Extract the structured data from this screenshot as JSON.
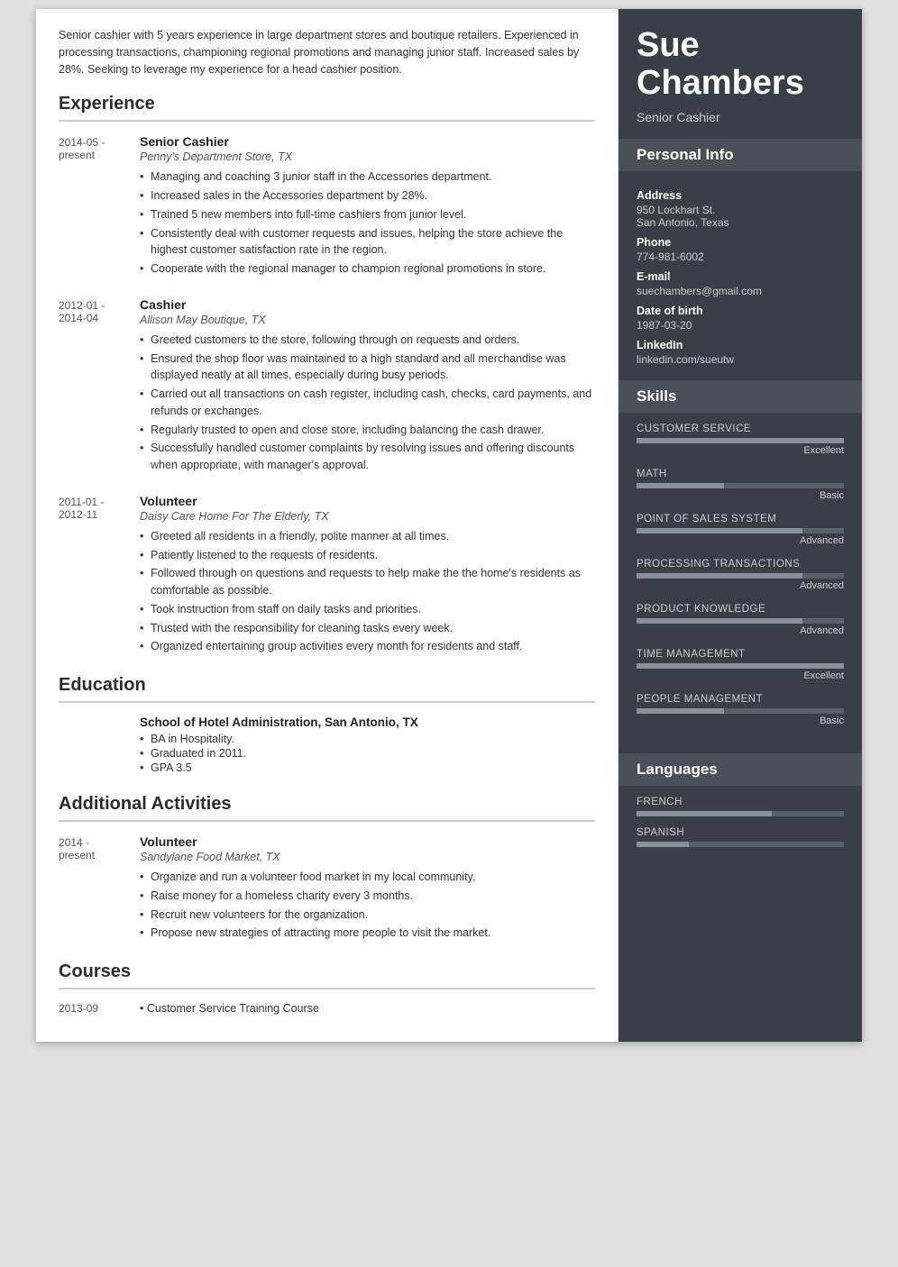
{
  "person": {
    "first_name": "Sue",
    "last_name": "Chambers",
    "job_title": "Senior Cashier"
  },
  "summary": "Senior cashier with 5 years experience in large department stores and boutique retailers. Experienced in processing transactions, championing regional promotions and managing junior staff. Increased sales by 28%. Seeking to leverage my experience for a head cashier position.",
  "sections": {
    "experience_title": "Experience",
    "education_title": "Education",
    "additional_title": "Additional Activities",
    "courses_title": "Courses"
  },
  "experience": [
    {
      "date": "2014-05 -\npresent",
      "title": "Senior Cashier",
      "company": "Penny's Department Store, TX",
      "bullets": [
        "Managing and coaching 3 junior staff in the Accessories department.",
        "Increased sales in the Accessories department by 28%.",
        "Trained 5 new members into full-time cashiers from junior level.",
        "Consistently deal with customer requests and issues, helping the store achieve the highest customer satisfaction rate in the region.",
        "Cooperate with the regional manager to champion regional promotions in store."
      ]
    },
    {
      "date": "2012-01 -\n2014-04",
      "title": "Cashier",
      "company": "Allison May Boutique, TX",
      "bullets": [
        "Greeted customers to the store, following through on requests and orders.",
        "Ensured the shop floor was maintained to a high standard and all merchandise was displayed neatly at all times, especially during busy periods.",
        "Carried out all transactions on cash register, including cash, checks, card payments, and refunds or exchanges.",
        "Regularly trusted to open and close store, including balancing the cash drawer.",
        "Successfully handled customer complaints by resolving issues and offering discounts when appropriate, with manager's approval."
      ]
    },
    {
      "date": "2011-01 -\n2012-11",
      "title": "Volunteer",
      "company": "Daisy Care Home For The Elderly, TX",
      "bullets": [
        "Greeted all residents in a friendly, polite manner at all times.",
        "Patiently listened to the requests of residents.",
        "Followed through on questions and requests to help make the the home's residents as comfortable as possible.",
        "Took instruction from staff on daily tasks and priorities.",
        "Trusted with the responsibility for cleaning tasks every week.",
        "Organized entertaining group activities every month for residents and staff."
      ]
    }
  ],
  "education": [
    {
      "date": "",
      "school": "School of Hotel Administration, San Antonio, TX",
      "bullets": [
        "BA in Hospitality.",
        "Graduated in 2011.",
        "GPA 3.5"
      ]
    }
  ],
  "additional": [
    {
      "date": "2014 -\npresent",
      "title": "Volunteer",
      "company": "Sandylane Food Market, TX",
      "bullets": [
        "Organize and run a volunteer food market in my local community.",
        "Raise money for a homeless charity every 3 months.",
        "Recruit new volunteers for the organization.",
        "Propose new strategies of attracting more people to visit the market."
      ]
    }
  ],
  "courses": [
    {
      "date": "2013-09",
      "name": "Customer Service Training Course"
    }
  ],
  "personal_info": {
    "address_label": "Address",
    "address_line1": "950 Lockhart St.",
    "address_line2": "San Antonio, Texas",
    "phone_label": "Phone",
    "phone": "774-981-6002",
    "email_label": "E-mail",
    "email": "suechambers@gmail.com",
    "dob_label": "Date of birth",
    "dob": "1987-03-20",
    "linkedin_label": "LinkedIn",
    "linkedin": "linkedin.com/sueutw"
  },
  "sidebar_sections": {
    "personal_info_title": "Personal Info",
    "skills_title": "Skills",
    "languages_title": "Languages"
  },
  "skills": [
    {
      "name": "CUSTOMER SERVICE",
      "level": "Excellent",
      "pct": 100
    },
    {
      "name": "MATH",
      "level": "Basic",
      "pct": 42
    },
    {
      "name": "POINT OF SALES SYSTEM",
      "level": "Advanced",
      "pct": 80
    },
    {
      "name": "PROCESSING TRANSACTIONS",
      "level": "Advanced",
      "pct": 80
    },
    {
      "name": "PRODUCT KNOWLEDGE",
      "level": "Advanced",
      "pct": 80
    },
    {
      "name": "TIME MANAGEMENT",
      "level": "Excellent",
      "pct": 100
    },
    {
      "name": "PEOPLE MANAGEMENT",
      "level": "Basic",
      "pct": 42
    }
  ],
  "languages": [
    {
      "name": "FRENCH",
      "pct": 65
    },
    {
      "name": "SPANISH",
      "pct": 25
    }
  ]
}
